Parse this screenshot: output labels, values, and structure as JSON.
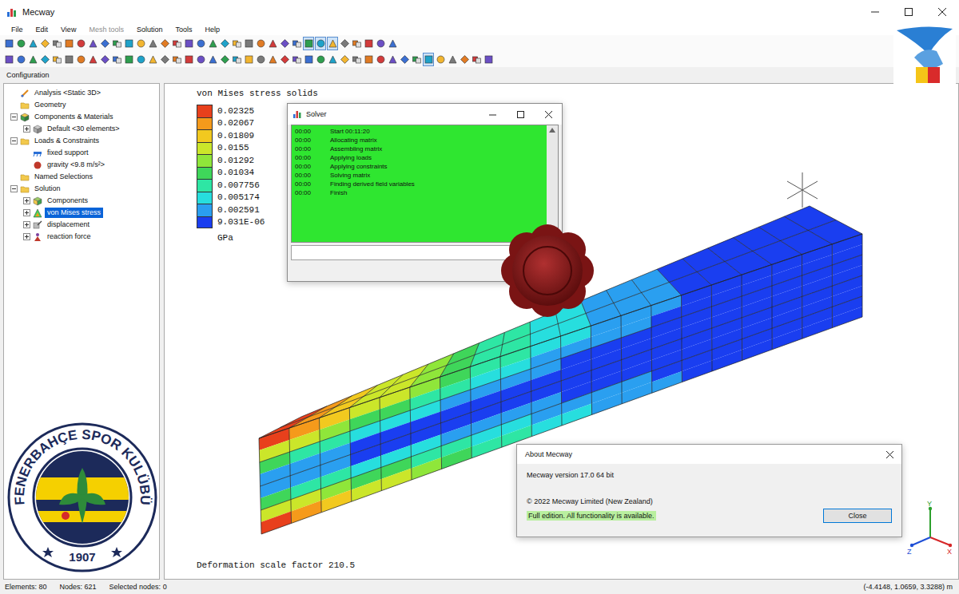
{
  "window": {
    "title": "Mecway"
  },
  "menu": [
    {
      "label": "File",
      "disabled": false
    },
    {
      "label": "Edit",
      "disabled": false
    },
    {
      "label": "View",
      "disabled": false
    },
    {
      "label": "Mesh tools",
      "disabled": true
    },
    {
      "label": "Solution",
      "disabled": false
    },
    {
      "label": "Tools",
      "disabled": false
    },
    {
      "label": "Help",
      "disabled": false
    }
  ],
  "toolbars": [
    {
      "buttons": [
        {
          "selected": false
        },
        {
          "selected": false
        },
        {
          "selected": false
        },
        {
          "selected": false
        },
        {
          "selected": false
        },
        {
          "selected": false
        },
        {
          "selected": false
        },
        {
          "selected": false
        },
        {
          "selected": false
        },
        {
          "selected": false
        },
        {
          "selected": false
        },
        {
          "selected": false
        },
        {
          "selected": false
        },
        {
          "selected": false
        },
        {
          "selected": false
        },
        {
          "selected": false
        },
        {
          "selected": false
        },
        {
          "selected": false
        },
        {
          "selected": false
        },
        {
          "selected": false
        },
        {
          "selected": false
        },
        {
          "selected": false
        },
        {
          "selected": false
        },
        {
          "selected": false
        },
        {
          "selected": false
        },
        {
          "selected": true
        },
        {
          "selected": true
        },
        {
          "selected": true
        },
        {
          "selected": false
        },
        {
          "selected": false
        },
        {
          "selected": false
        },
        {
          "selected": false
        },
        {
          "selected": false
        }
      ]
    },
    {
      "buttons": [
        {
          "selected": false
        },
        {
          "selected": false
        },
        {
          "selected": false
        },
        {
          "selected": false
        },
        {
          "selected": false
        },
        {
          "selected": false
        },
        {
          "selected": false
        },
        {
          "selected": false
        },
        {
          "selected": false
        },
        {
          "selected": false
        },
        {
          "selected": false
        },
        {
          "selected": false
        },
        {
          "selected": false
        },
        {
          "selected": false
        },
        {
          "selected": false
        },
        {
          "selected": false
        },
        {
          "selected": false
        },
        {
          "selected": false
        },
        {
          "selected": false
        },
        {
          "selected": false
        },
        {
          "selected": false
        },
        {
          "selected": false
        },
        {
          "selected": false
        },
        {
          "selected": false
        },
        {
          "selected": false
        },
        {
          "selected": false
        },
        {
          "selected": false
        },
        {
          "selected": false
        },
        {
          "selected": false
        },
        {
          "selected": false
        },
        {
          "selected": false
        },
        {
          "selected": false
        },
        {
          "selected": false
        },
        {
          "selected": false
        },
        {
          "selected": false
        },
        {
          "selected": true
        },
        {
          "selected": false
        },
        {
          "selected": false
        },
        {
          "selected": false
        },
        {
          "selected": false
        },
        {
          "selected": false
        }
      ]
    }
  ],
  "panel": {
    "title": "Configuration"
  },
  "tree": [
    {
      "label": "Analysis <Static 3D>",
      "level": 0,
      "kind": "analysis",
      "has_children": false,
      "expanded": false,
      "selected": false
    },
    {
      "label": "Geometry",
      "level": 0,
      "kind": "folder",
      "has_children": false,
      "expanded": false,
      "selected": false
    },
    {
      "label": "Components & Materials",
      "level": 0,
      "kind": "material",
      "has_children": true,
      "expanded": true,
      "selected": false
    },
    {
      "label": "Default <30 elements>",
      "level": 1,
      "kind": "mesh",
      "has_children": true,
      "expanded": false,
      "selected": false
    },
    {
      "label": "Loads & Constraints",
      "level": 0,
      "kind": "folder",
      "has_children": true,
      "expanded": true,
      "selected": false
    },
    {
      "label": "fixed support",
      "level": 1,
      "kind": "support",
      "has_children": false,
      "expanded": false,
      "selected": false
    },
    {
      "label": "gravity <9.8 m/s²>",
      "level": 1,
      "kind": "gravity",
      "has_children": false,
      "expanded": false,
      "selected": false
    },
    {
      "label": "Named Selections",
      "level": 0,
      "kind": "folder",
      "has_children": false,
      "expanded": false,
      "selected": false
    },
    {
      "label": "Solution",
      "level": 0,
      "kind": "folder",
      "has_children": true,
      "expanded": true,
      "selected": false
    },
    {
      "label": "Components",
      "level": 1,
      "kind": "component",
      "has_children": true,
      "expanded": false,
      "selected": false
    },
    {
      "label": "von Mises stress",
      "level": 1,
      "kind": "stress",
      "has_children": true,
      "expanded": false,
      "selected": true
    },
    {
      "label": "displacement",
      "level": 1,
      "kind": "displacement",
      "has_children": true,
      "expanded": false,
      "selected": false
    },
    {
      "label": "reaction force",
      "level": 1,
      "kind": "reaction",
      "has_children": true,
      "expanded": false,
      "selected": false
    }
  ],
  "plot": {
    "title": "von Mises stress solids",
    "unit": "GPa",
    "legend": [
      {
        "value": "0.02325",
        "color": "#e8401c"
      },
      {
        "value": "0.02067",
        "color": "#f59a1b"
      },
      {
        "value": "0.01809",
        "color": "#f2c91f"
      },
      {
        "value": "0.0155",
        "color": "#cbe62a"
      },
      {
        "value": "0.01292",
        "color": "#8fe63a"
      },
      {
        "value": "0.01034",
        "color": "#3fd65a"
      },
      {
        "value": "0.007756",
        "color": "#2ee6a4"
      },
      {
        "value": "0.005174",
        "color": "#27dede"
      },
      {
        "value": "0.002591",
        "color": "#2a9ff0"
      },
      {
        "value": "9.031E-06",
        "color": "#1a3ef0"
      }
    ],
    "footer": "Deformation scale factor 210.5",
    "axes": [
      {
        "label": "Y",
        "color": "#2ca02c"
      },
      {
        "label": "X",
        "color": "#d62728"
      },
      {
        "label": "Z",
        "color": "#1f4fd6"
      }
    ]
  },
  "solver": {
    "title": "Solver",
    "log": [
      {
        "time": "00:00",
        "message": "Start 00:11:20"
      },
      {
        "time": "00:00",
        "message": "Allocating matrix"
      },
      {
        "time": "00:00",
        "message": "Assembling matrix"
      },
      {
        "time": "00:00",
        "message": "Applying loads"
      },
      {
        "time": "00:00",
        "message": "Applying constraints"
      },
      {
        "time": "00:00",
        "message": "Solving matrix"
      },
      {
        "time": "00:00",
        "message": "Finding derived field variables"
      },
      {
        "time": "00:00",
        "message": "Finish"
      }
    ]
  },
  "about": {
    "title": "About Mecway",
    "lines": [
      "Mecway version 17.0 64 bit",
      "© 2022 Mecway Limited (New Zealand)"
    ],
    "highlight": "Full edition. All functionality is available.",
    "button": "Close"
  },
  "badge": {
    "name": "FENERBAHÇE SPOR KULÜBÜ",
    "year": "1907"
  },
  "status_bar": {
    "items": [
      "Elements: 80",
      "Nodes: 621",
      "Selected nodes: 0"
    ],
    "coordinates": "(-4.4148, 1.0659, 3.3288) m"
  }
}
